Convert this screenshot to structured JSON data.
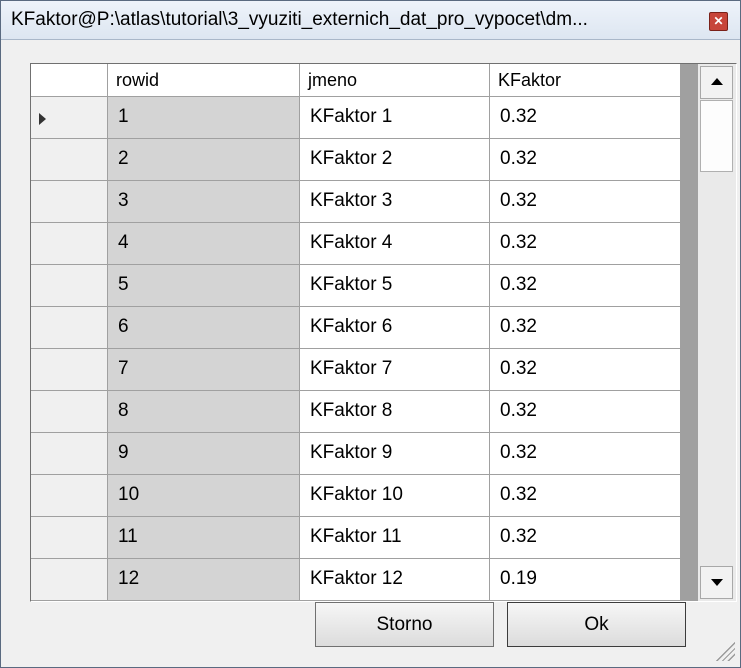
{
  "window": {
    "title": "KFaktor@P:\\atlas\\tutorial\\3_vyuziti_externich_dat_pro_vypocet\\dm...",
    "close_icon": "close-icon"
  },
  "grid": {
    "columns": [
      "rowid",
      "jmeno",
      "KFaktor"
    ],
    "current_row_indicator": "row-pointer-icon",
    "rows": [
      {
        "rowid": "1",
        "jmeno": "KFaktor 1",
        "kfaktor": "0.32"
      },
      {
        "rowid": "2",
        "jmeno": "KFaktor 2",
        "kfaktor": "0.32"
      },
      {
        "rowid": "3",
        "jmeno": "KFaktor 3",
        "kfaktor": "0.32"
      },
      {
        "rowid": "4",
        "jmeno": "KFaktor 4",
        "kfaktor": "0.32"
      },
      {
        "rowid": "5",
        "jmeno": "KFaktor 5",
        "kfaktor": "0.32"
      },
      {
        "rowid": "6",
        "jmeno": "KFaktor 6",
        "kfaktor": "0.32"
      },
      {
        "rowid": "7",
        "jmeno": "KFaktor 7",
        "kfaktor": "0.32"
      },
      {
        "rowid": "8",
        "jmeno": "KFaktor 8",
        "kfaktor": "0.32"
      },
      {
        "rowid": "9",
        "jmeno": "KFaktor 9",
        "kfaktor": "0.32"
      },
      {
        "rowid": "10",
        "jmeno": "KFaktor 10",
        "kfaktor": "0.32"
      },
      {
        "rowid": "11",
        "jmeno": "KFaktor 11",
        "kfaktor": "0.32"
      },
      {
        "rowid": "12",
        "jmeno": "KFaktor 12",
        "kfaktor": "0.19"
      }
    ]
  },
  "buttons": {
    "storno": "Storno",
    "ok": "Ok"
  },
  "colors": {
    "rowid_column_bg": "#d4d4d4",
    "titlebar_bg": "#dde6f1",
    "close_button": "#c7453a"
  }
}
